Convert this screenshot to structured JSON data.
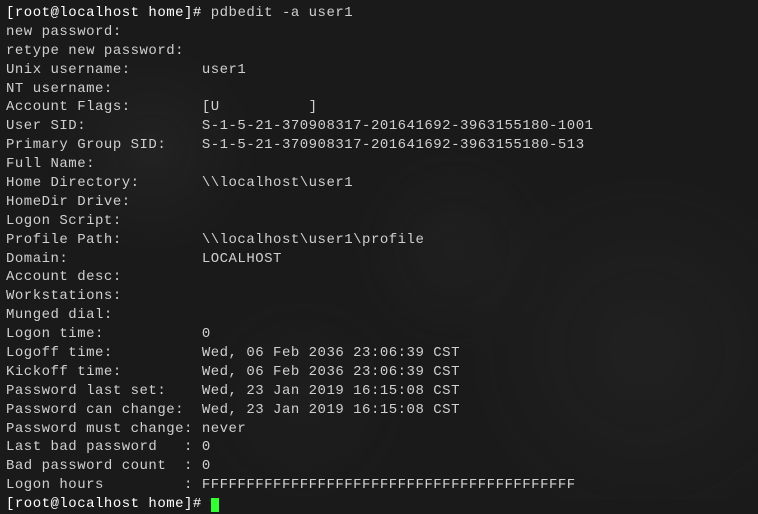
{
  "prompt1_text": "[root@localhost home]# ",
  "cmd": "pdbedit -a user1",
  "new_password_prompt": "new password:",
  "retype_password_prompt": "retype new password:",
  "field_unix_username": "Unix username:        user1",
  "field_nt_username": "NT username:",
  "field_account_flags": "Account Flags:        [U          ]",
  "field_user_sid": "User SID:             S-1-5-21-370908317-201641692-3963155180-1001",
  "field_primary_group_sid": "Primary Group SID:    S-1-5-21-370908317-201641692-3963155180-513",
  "field_full_name": "Full Name:",
  "field_home_directory": "Home Directory:       \\\\localhost\\user1",
  "field_homedir_drive": "HomeDir Drive:",
  "field_logon_script": "Logon Script:",
  "field_profile_path": "Profile Path:         \\\\localhost\\user1\\profile",
  "field_domain": "Domain:               LOCALHOST",
  "field_account_desc": "Account desc:",
  "field_workstations": "Workstations:",
  "field_munged_dial": "Munged dial:",
  "field_logon_time": "Logon time:           0",
  "field_logoff_time": "Logoff time:          Wed, 06 Feb 2036 23:06:39 CST",
  "field_kickoff_time": "Kickoff time:         Wed, 06 Feb 2036 23:06:39 CST",
  "field_password_last_set": "Password last set:    Wed, 23 Jan 2019 16:15:08 CST",
  "field_password_can_change": "Password can change:  Wed, 23 Jan 2019 16:15:08 CST",
  "field_password_must_change": "Password must change: never",
  "field_last_bad_password": "Last bad password   : 0",
  "field_bad_password_count": "Bad password count  : 0",
  "field_logon_hours": "Logon hours         : FFFFFFFFFFFFFFFFFFFFFFFFFFFFFFFFFFFFFFFFFF",
  "prompt2_text": "[root@localhost home]# "
}
